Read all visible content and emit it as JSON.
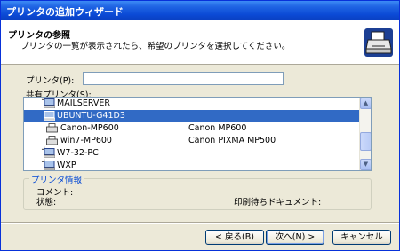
{
  "window": {
    "title": "プリンタの追加ウィザード"
  },
  "header": {
    "title": "プリンタの参照",
    "subtitle": "プリンタの一覧が表示されたら、希望のプリンタを選択してください。",
    "icon": "printer-icon"
  },
  "printer_field": {
    "label": "プリンタ(P):",
    "value": ""
  },
  "shared_printers": {
    "label": "共有プリンタ(S):",
    "items": [
      {
        "name": "MAILSERVER",
        "description": "",
        "type": "server",
        "icon": "computer-icon",
        "expandable": true,
        "selected": false
      },
      {
        "name": "UBUNTU-G41D3",
        "description": "",
        "type": "server",
        "icon": "computer-icon",
        "expandable": true,
        "selected": true
      },
      {
        "name": "Canon-MP600",
        "description": "Canon MP600",
        "type": "printer",
        "icon": "printer-icon",
        "expandable": false,
        "selected": false
      },
      {
        "name": "win7-MP600",
        "description": "Canon PIXMA MP500",
        "type": "printer",
        "icon": "printer-icon",
        "expandable": false,
        "selected": false
      },
      {
        "name": "W7-32-PC",
        "description": "",
        "type": "server",
        "icon": "computer-icon",
        "expandable": true,
        "selected": false
      },
      {
        "name": "WXP",
        "description": "",
        "type": "server",
        "icon": "computer-icon",
        "expandable": true,
        "selected": false
      }
    ]
  },
  "printer_info": {
    "legend": "プリンタ情報",
    "comment_label": "コメント:",
    "status_label": "状態:",
    "queue_label": "印刷待ちドキュメント:"
  },
  "buttons": {
    "back": "< 戻る(B)",
    "next": "次へ(N) >",
    "cancel": "キャンセル"
  },
  "colors": {
    "title_bar": "#0a3fc0",
    "selection": "#316ac5",
    "dialog_bg": "#ece9d8",
    "group_legend": "#0046d5"
  }
}
